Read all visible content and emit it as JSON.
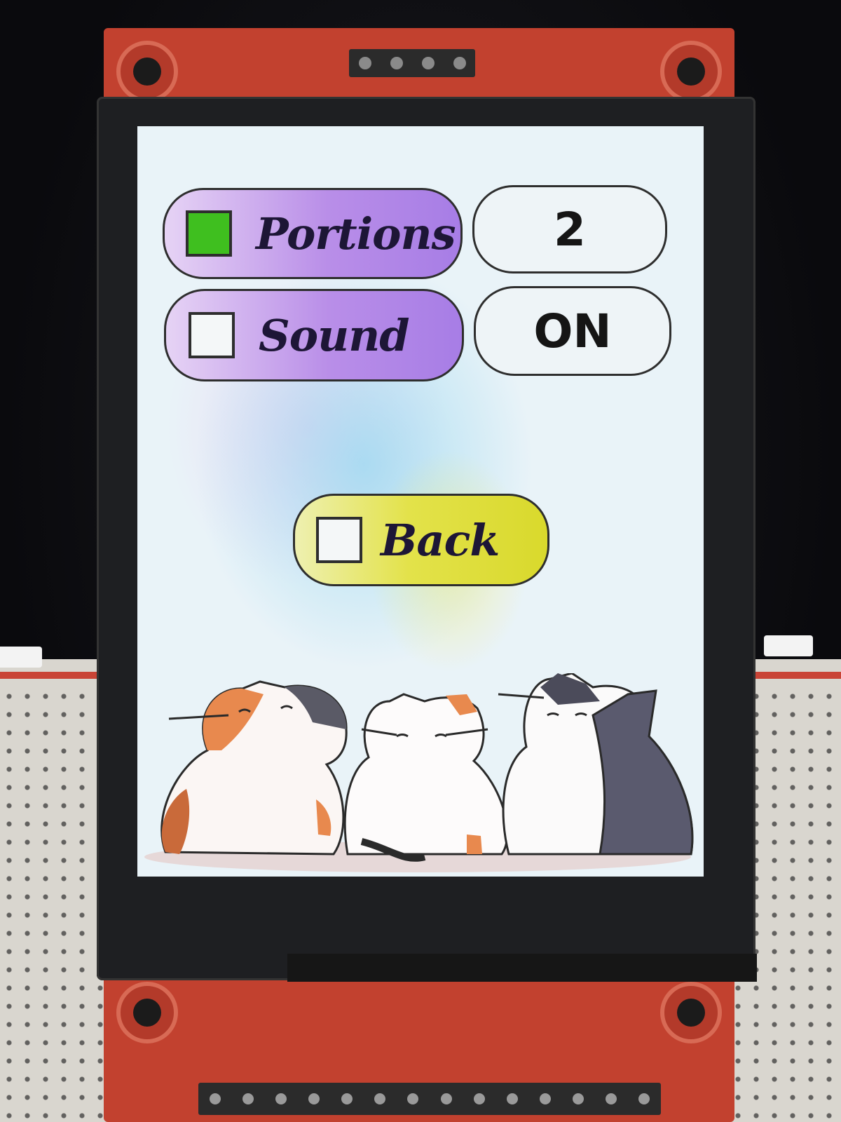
{
  "settings_menu": {
    "portions": {
      "label": "Portions",
      "checked": true,
      "value": "2"
    },
    "sound": {
      "label": "Sound",
      "checked": false,
      "value": "ON"
    },
    "back": {
      "label": "Back",
      "checked": false
    }
  },
  "colors": {
    "option_button": "#b98ee8",
    "back_button": "#e3e24a",
    "checkbox_checked": "#3fbf1f",
    "value_box": "#eef4f7",
    "outline": "#2e2e2e"
  },
  "illustration": {
    "subject": "three cartoon cats",
    "icon": "cats-illustration"
  }
}
